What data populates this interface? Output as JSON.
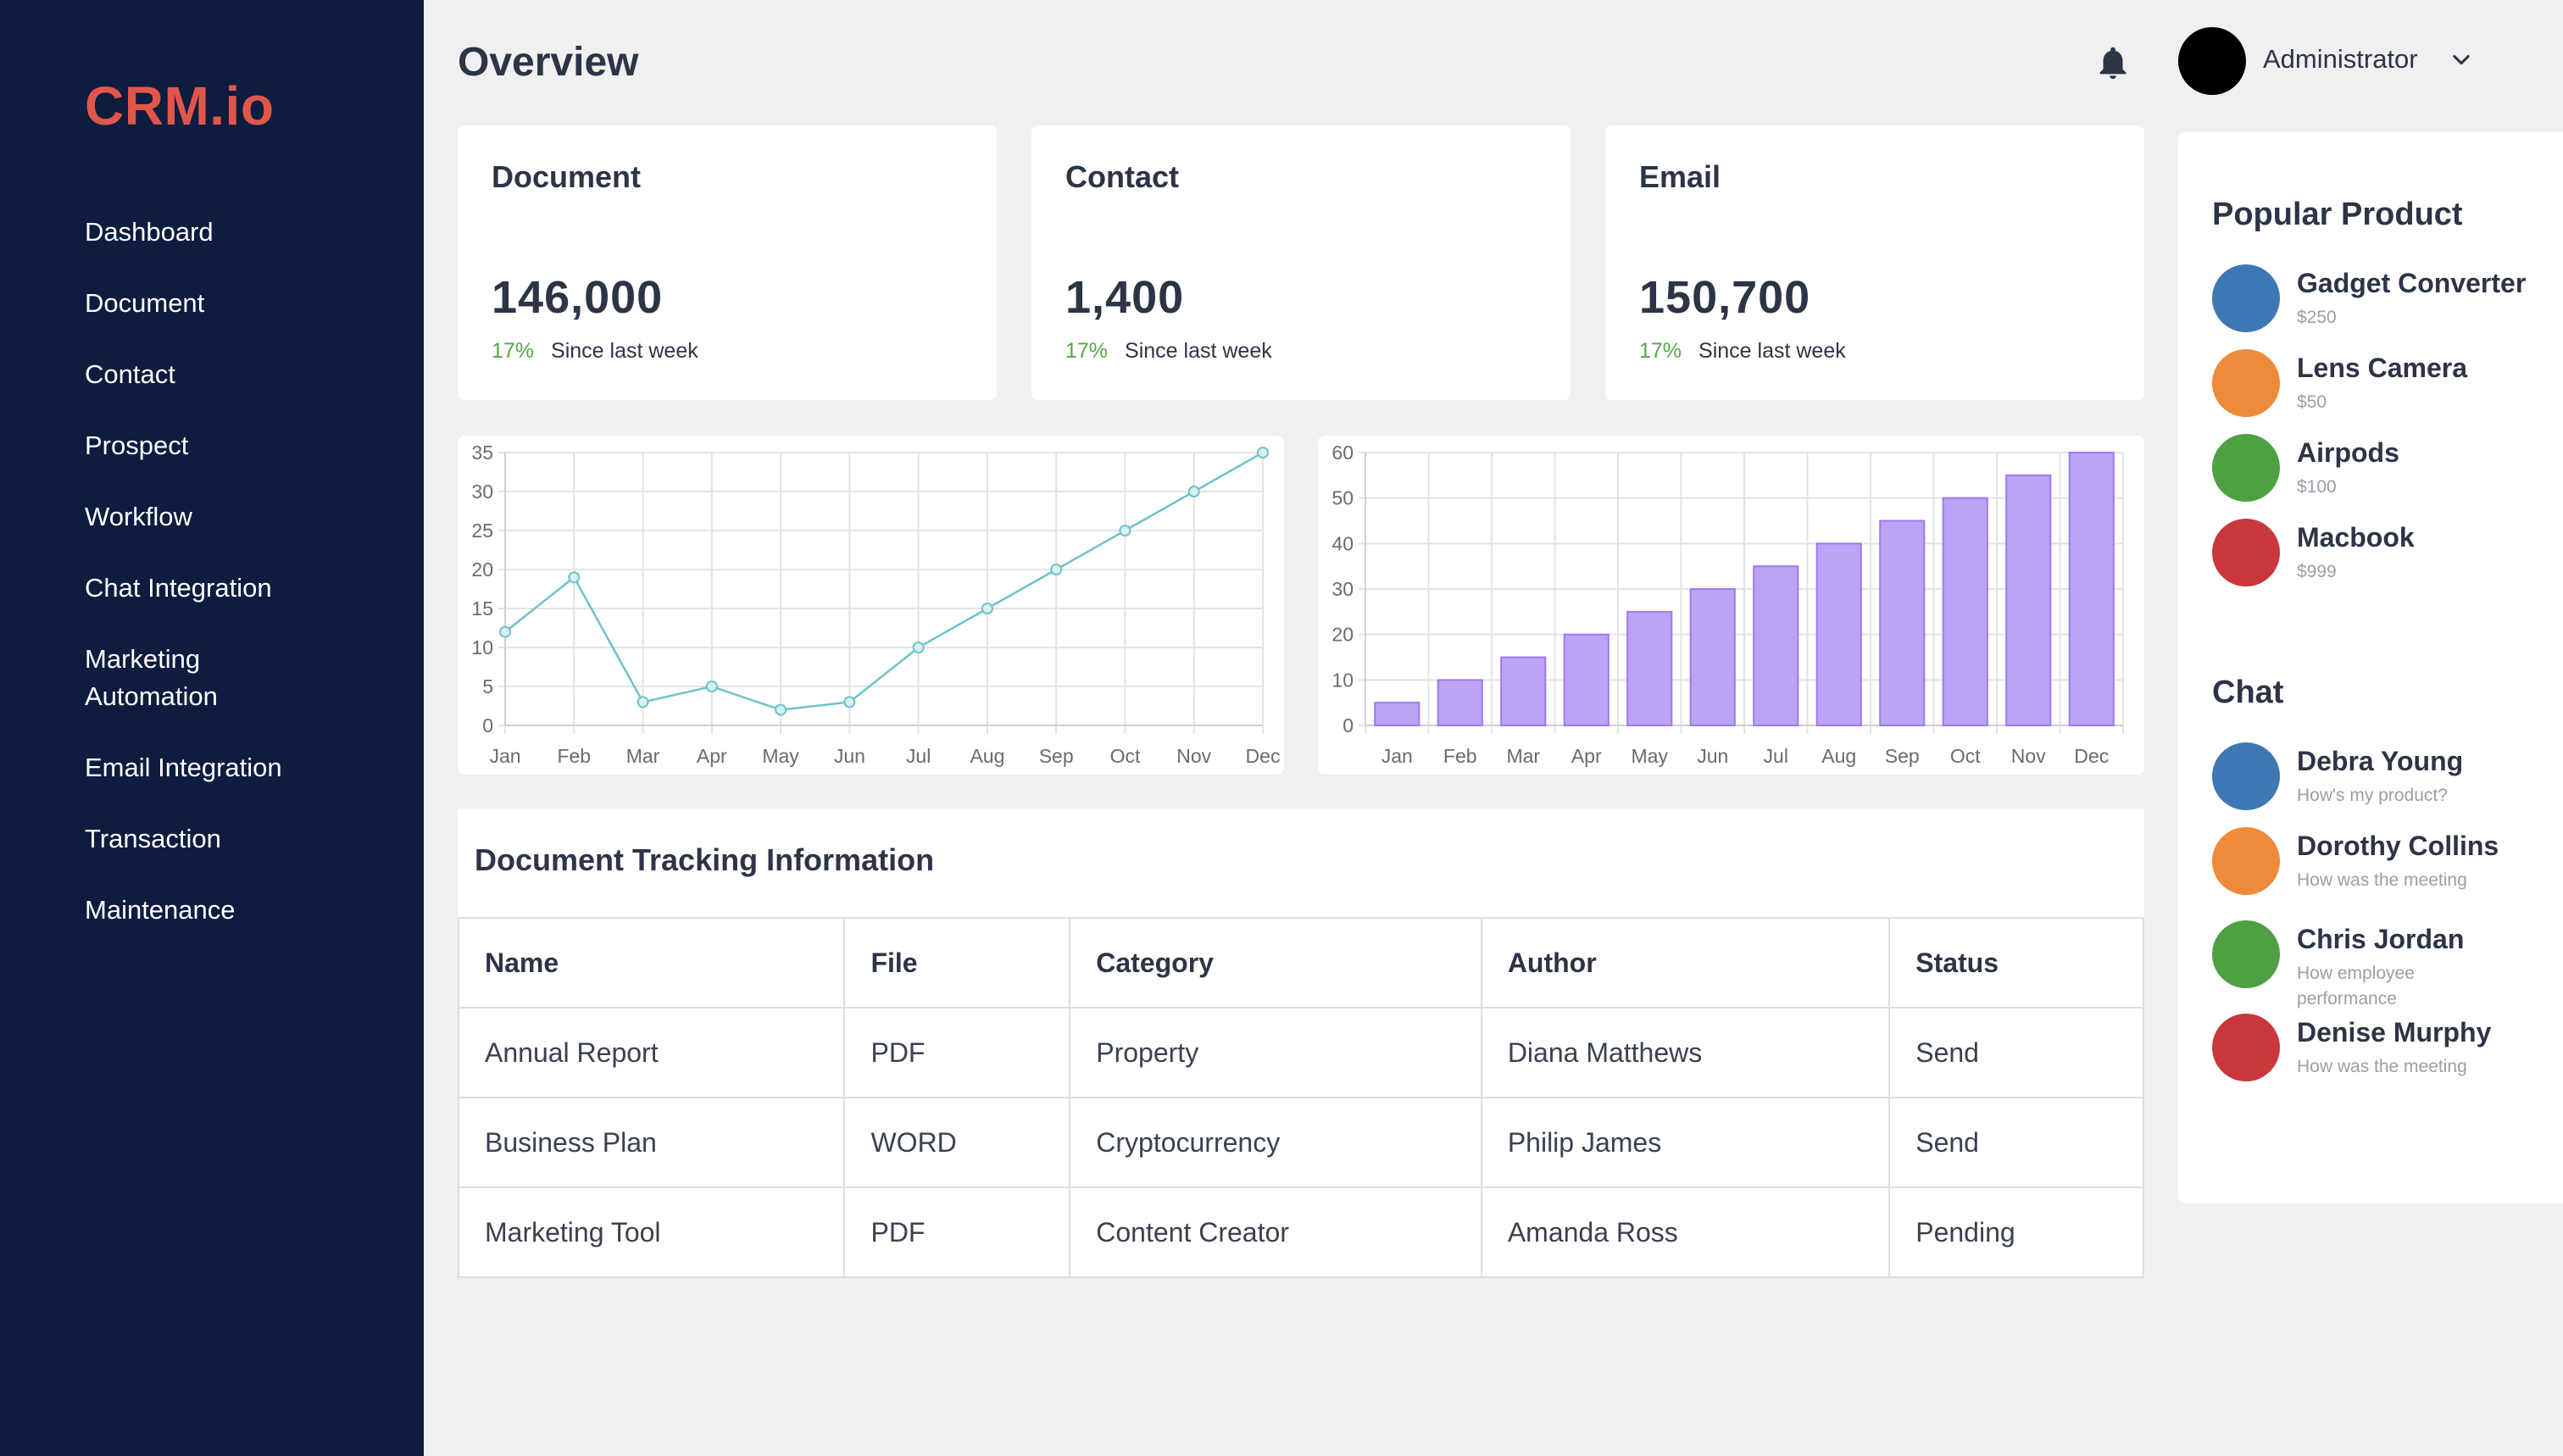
{
  "brand": {
    "name": "CRM.io",
    "color": "#e0574a"
  },
  "sidebar": {
    "items": [
      {
        "label": "Dashboard"
      },
      {
        "label": "Document"
      },
      {
        "label": "Contact"
      },
      {
        "label": "Prospect"
      },
      {
        "label": "Workflow"
      },
      {
        "label": "Chat Integration"
      },
      {
        "label": "Marketing Automation"
      },
      {
        "label": "Email Integration"
      },
      {
        "label": "Transaction"
      },
      {
        "label": "Maintenance"
      }
    ]
  },
  "header": {
    "title": "Overview",
    "user": {
      "name": "Administrator"
    },
    "icons": [
      "bell-icon",
      "chevron-down-icon"
    ]
  },
  "stats": [
    {
      "title": "Document",
      "value": "146,000",
      "change": "17%",
      "since": "Since last week"
    },
    {
      "title": "Contact",
      "value": "1,400",
      "change": "17%",
      "since": "Since last week"
    },
    {
      "title": "Email",
      "value": "150,700",
      "change": "17%",
      "since": "Since last week"
    }
  ],
  "chart_data": [
    {
      "type": "line",
      "categories": [
        "Jan",
        "Feb",
        "Mar",
        "Apr",
        "May",
        "Jun",
        "Jul",
        "Aug",
        "Sep",
        "Oct",
        "Nov",
        "Dec"
      ],
      "values": [
        12,
        19,
        3,
        5,
        2,
        3,
        10,
        15,
        20,
        25,
        30,
        35
      ],
      "ylim": [
        0,
        35
      ],
      "yticks": [
        0,
        5,
        10,
        15,
        20,
        25,
        30,
        35
      ],
      "grid": true,
      "color": "#6ec3c9"
    },
    {
      "type": "bar",
      "categories": [
        "Jan",
        "Feb",
        "Mar",
        "Apr",
        "May",
        "Jun",
        "Jul",
        "Aug",
        "Sep",
        "Oct",
        "Nov",
        "Dec"
      ],
      "values": [
        5,
        10,
        15,
        20,
        25,
        30,
        35,
        40,
        45,
        50,
        55,
        60
      ],
      "ylim": [
        0,
        60
      ],
      "yticks": [
        0,
        10,
        20,
        30,
        40,
        50,
        60
      ],
      "grid": true,
      "color": "#bba3f6",
      "border_color": "#a078ee"
    }
  ],
  "table": {
    "title": "Document Tracking Information",
    "columns": [
      "Name",
      "File",
      "Category",
      "Author",
      "Status"
    ],
    "rows": [
      [
        "Annual Report",
        "PDF",
        "Property",
        "Diana Matthews",
        "Send"
      ],
      [
        "Business Plan",
        "WORD",
        "Cryptocurrency",
        "Philip James",
        "Send"
      ],
      [
        "Marketing Tool",
        "PDF",
        "Content Creator",
        "Amanda Ross",
        "Pending"
      ]
    ]
  },
  "popular": {
    "title": "Popular Product",
    "items": [
      {
        "name": "Gadget Converter",
        "price": "$250",
        "color": "#3d78b5"
      },
      {
        "name": "Lens Camera",
        "price": "$50",
        "color": "#ef8a3a"
      },
      {
        "name": "Airpods",
        "price": "$100",
        "color": "#4ea043"
      },
      {
        "name": "Macbook",
        "price": "$999",
        "color": "#c9383a"
      }
    ]
  },
  "chat": {
    "title": "Chat",
    "items": [
      {
        "name": "Debra Young",
        "message": "How's my product?",
        "color": "#3d78b5"
      },
      {
        "name": "Dorothy Collins",
        "message": "How was the meeting",
        "color": "#ef8a3a"
      },
      {
        "name": "Chris Jordan",
        "message": "How employee performance",
        "color": "#4ea043"
      },
      {
        "name": "Denise Murphy",
        "message": "How was the meeting",
        "color": "#c9383a"
      }
    ]
  }
}
